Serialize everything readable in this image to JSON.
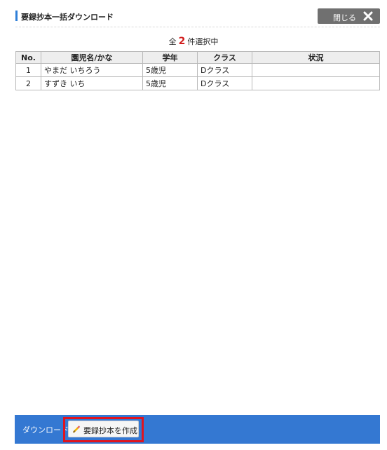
{
  "header": {
    "title": "要録抄本一括ダウンロード",
    "close_label": "閉じる"
  },
  "selection": {
    "prefix": "全",
    "count": "2",
    "suffix": "件選択中"
  },
  "table": {
    "columns": [
      "No.",
      "園児名/かな",
      "学年",
      "クラス",
      "状況"
    ],
    "rows": [
      {
        "no": "1",
        "name": "やまだ いちろう",
        "grade": "5歳児",
        "class": "Dクラス",
        "status": ""
      },
      {
        "no": "2",
        "name": "すずき いち",
        "grade": "5歳児",
        "class": "Dクラス",
        "status": ""
      }
    ]
  },
  "footer": {
    "label": "ダウンロード",
    "create_button_label": "要録抄本を作成"
  },
  "colors": {
    "accent_blue": "#3478d2",
    "title_bar": "#2f7fd8",
    "close_button": "#707070",
    "count_red": "#d21e1e",
    "highlight_red": "#e0141e"
  },
  "icons": {
    "close": "close-icon",
    "create": "pencil-icon"
  }
}
